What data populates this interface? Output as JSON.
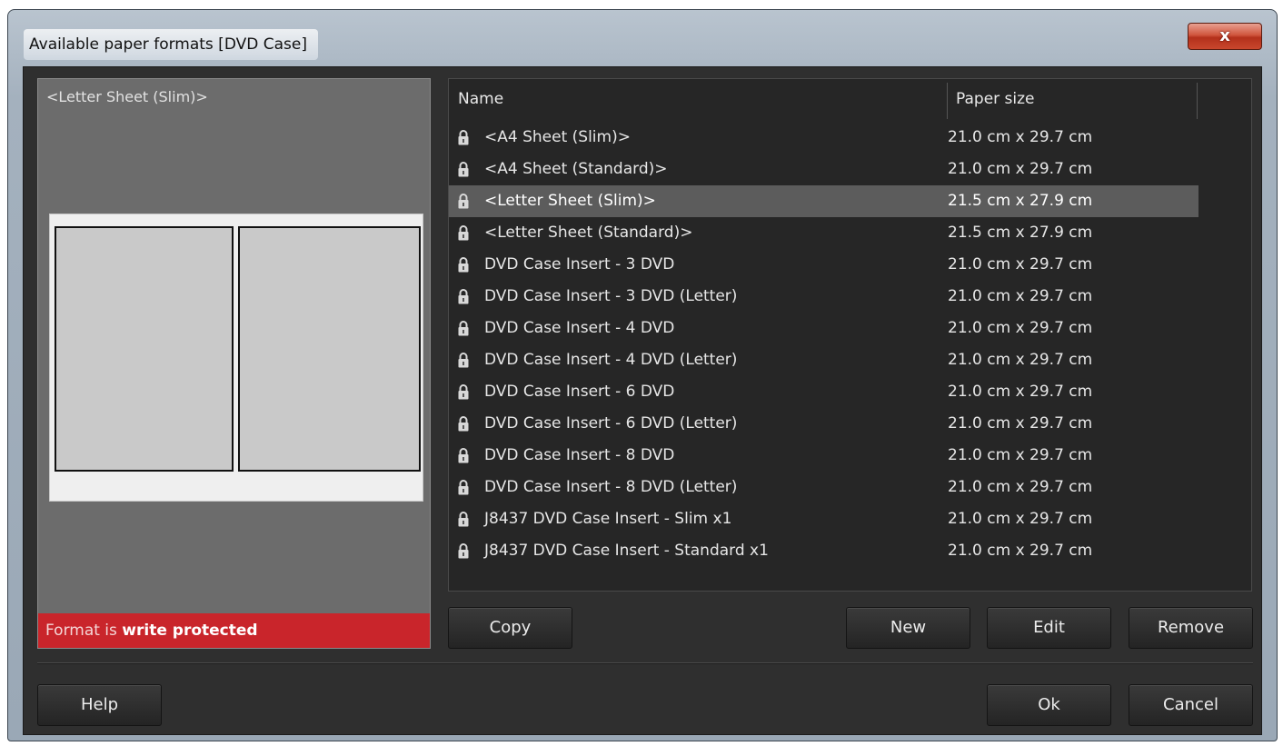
{
  "window": {
    "title": "Available paper formats [DVD Case]",
    "close_glyph": "x"
  },
  "preview": {
    "title": "<Letter Sheet (Slim)>",
    "protect_prefix": "Format is ",
    "protect_bold": "write protected"
  },
  "list": {
    "columns": [
      "Name",
      "Paper size"
    ],
    "rows": [
      {
        "name": "<A4 Sheet (Slim)>",
        "size": "21.0 cm x 29.7 cm",
        "locked": true
      },
      {
        "name": "<A4 Sheet (Standard)>",
        "size": "21.0 cm x 29.7 cm",
        "locked": true
      },
      {
        "name": "<Letter Sheet (Slim)>",
        "size": "21.5 cm x 27.9 cm",
        "locked": true,
        "selected": true
      },
      {
        "name": "<Letter Sheet (Standard)>",
        "size": "21.5 cm x 27.9 cm",
        "locked": true
      },
      {
        "name": "DVD Case Insert - 3 DVD",
        "size": "21.0 cm x 29.7 cm",
        "locked": true
      },
      {
        "name": "DVD Case Insert - 3 DVD (Letter)",
        "size": "21.0 cm x 29.7 cm",
        "locked": true
      },
      {
        "name": "DVD Case Insert - 4 DVD",
        "size": "21.0 cm x 29.7 cm",
        "locked": true
      },
      {
        "name": "DVD Case Insert - 4 DVD (Letter)",
        "size": "21.0 cm x 29.7 cm",
        "locked": true
      },
      {
        "name": "DVD Case Insert - 6 DVD",
        "size": "21.0 cm x 29.7 cm",
        "locked": true
      },
      {
        "name": "DVD Case Insert - 6 DVD (Letter)",
        "size": "21.0 cm x 29.7 cm",
        "locked": true
      },
      {
        "name": "DVD Case Insert - 8 DVD",
        "size": "21.0 cm x 29.7 cm",
        "locked": true
      },
      {
        "name": "DVD Case Insert - 8 DVD (Letter)",
        "size": "21.0 cm x 29.7 cm",
        "locked": true
      },
      {
        "name": "J8437 DVD Case Insert - Slim x1",
        "size": "21.0 cm x 29.7 cm",
        "locked": true
      },
      {
        "name": "J8437 DVD Case Insert - Standard x1",
        "size": "21.0 cm x 29.7 cm",
        "locked": true
      }
    ]
  },
  "buttons": {
    "copy": "Copy",
    "new": "New",
    "edit": "Edit",
    "remove": "Remove",
    "help": "Help",
    "ok": "Ok",
    "cancel": "Cancel"
  },
  "icons": {
    "lock": "lock-icon",
    "close": "close-icon"
  },
  "colors": {
    "protect_bar": "#c9252b",
    "selected_row": "#5c5c5c",
    "close_button": "#c9472d"
  }
}
